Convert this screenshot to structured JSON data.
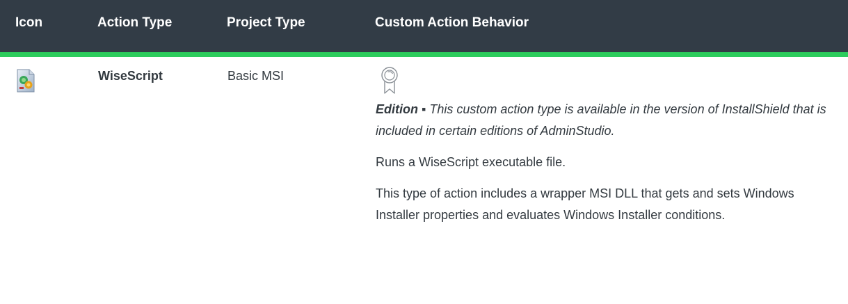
{
  "table": {
    "headers": {
      "icon": "Icon",
      "action_type": "Action Type",
      "project_type": "Project Type",
      "behavior": "Custom Action Behavior"
    },
    "rows": [
      {
        "icon": "wisescript-file-icon",
        "action_type": "WiseScript",
        "project_type": "Basic MSI",
        "behavior": {
          "badge_icon": "edition-ribbon-icon",
          "edition_label": "Edition ▪",
          "edition_text": "This custom action type is available in the version of InstallShield that is included in certain editions of AdminStudio.",
          "paragraphs": [
            "Runs a WiseScript executable file.",
            "This type of action includes a wrapper MSI DLL that gets and sets Windows Installer properties and evaluates Windows Installer conditions."
          ]
        }
      }
    ]
  },
  "colors": {
    "header_bg": "#323c46",
    "header_text": "#ffffff",
    "accent_rule": "#2ccc5c",
    "body_text": "#333a40"
  }
}
